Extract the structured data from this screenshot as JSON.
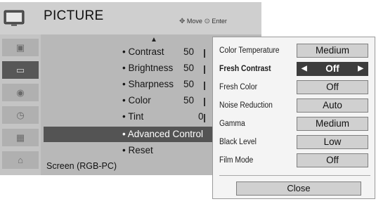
{
  "header": {
    "title": "PICTURE",
    "hint_move": "Move",
    "hint_enter": "Enter",
    "icon": "tv-icon",
    "move_icon": "four-way-arrow-icon",
    "enter_icon": "enter-dot-icon"
  },
  "sidebar": {
    "icons": [
      "picture-thumb-icon",
      "tv-screen-icon",
      "audio-icon",
      "clock-icon",
      "option-icon",
      "lock-icon"
    ],
    "active_index": 1
  },
  "menu": {
    "items": [
      {
        "label": "• Contrast",
        "value": "50"
      },
      {
        "label": "• Brightness",
        "value": "50"
      },
      {
        "label": "• Sharpness",
        "value": "50"
      },
      {
        "label": "• Color",
        "value": "50"
      },
      {
        "label": "• Tint",
        "value": "0"
      },
      {
        "label": "• Advanced Control",
        "value": ""
      },
      {
        "label": "• Reset",
        "value": ""
      }
    ],
    "selected_index": 5,
    "screen_label": "Screen (RGB-PC)"
  },
  "popup": {
    "rows": [
      {
        "label": "Color Temperature",
        "value": "Medium"
      },
      {
        "label": "Fresh Contrast",
        "value": "Off"
      },
      {
        "label": "Fresh Color",
        "value": "Off"
      },
      {
        "label": "Noise Reduction",
        "value": "Auto"
      },
      {
        "label": "Gamma",
        "value": "Medium"
      },
      {
        "label": "Black Level",
        "value": "Low"
      },
      {
        "label": "Film Mode",
        "value": "Off"
      }
    ],
    "active_index": 1,
    "close_label": "Close"
  }
}
